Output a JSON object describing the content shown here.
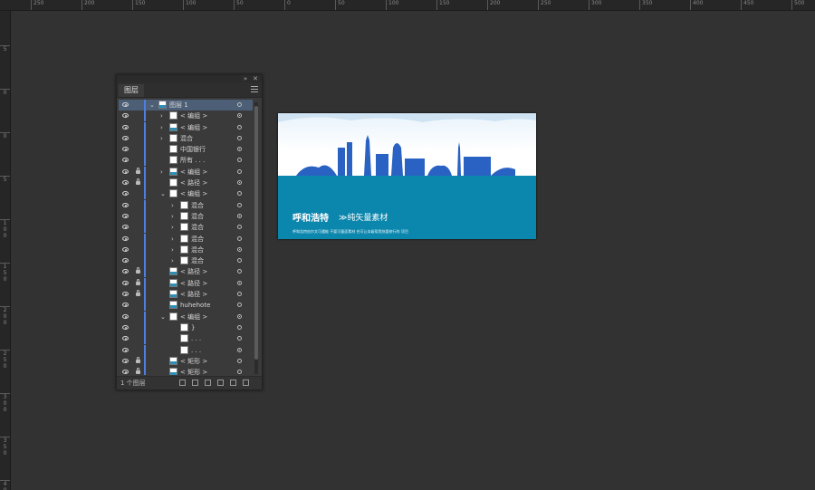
{
  "ruler": {
    "top_labels": [
      "250",
      "200",
      "150",
      "100",
      "50",
      "0",
      "50",
      "100",
      "150",
      "200",
      "250",
      "300",
      "350",
      "400",
      "450",
      "500"
    ],
    "left_labels": [
      "5",
      "0",
      "0",
      "5",
      "100",
      "150",
      "200",
      "250",
      "300",
      "350",
      "400"
    ]
  },
  "panel": {
    "collapse_icon": "double-arrow-icon",
    "close_icon": "close-icon",
    "tab_label": "图层",
    "footer_text": "1 个图层",
    "rows": [
      {
        "label": "图层 1",
        "eye": true,
        "lock": false,
        "twisty": "v",
        "indent": 0,
        "thumb": "pic",
        "selected": true
      },
      {
        "label": "< 编组 >",
        "eye": true,
        "lock": false,
        "twisty": ">",
        "indent": 1,
        "thumb": "white"
      },
      {
        "label": "< 编组 >",
        "eye": true,
        "lock": false,
        "twisty": ">",
        "indent": 1,
        "thumb": "pic"
      },
      {
        "label": "混合",
        "eye": true,
        "lock": false,
        "twisty": ">",
        "indent": 1,
        "thumb": "white"
      },
      {
        "label": "中国银行",
        "eye": true,
        "lock": false,
        "twisty": "",
        "indent": 1,
        "thumb": "white"
      },
      {
        "label": "所有 . . .",
        "eye": true,
        "lock": false,
        "twisty": "",
        "indent": 1,
        "thumb": "white"
      },
      {
        "label": "< 编组 >",
        "eye": true,
        "lock": true,
        "twisty": ">",
        "indent": 1,
        "thumb": "pic"
      },
      {
        "label": "< 路径 >",
        "eye": true,
        "lock": true,
        "twisty": "",
        "indent": 1,
        "thumb": "white"
      },
      {
        "label": "< 编组 >",
        "eye": true,
        "lock": false,
        "twisty": "v",
        "indent": 1,
        "thumb": "white"
      },
      {
        "label": "混合",
        "eye": true,
        "lock": false,
        "twisty": ">",
        "indent": 2,
        "thumb": "white"
      },
      {
        "label": "混合",
        "eye": true,
        "lock": false,
        "twisty": ">",
        "indent": 2,
        "thumb": "white"
      },
      {
        "label": "混合",
        "eye": true,
        "lock": false,
        "twisty": ">",
        "indent": 2,
        "thumb": "white"
      },
      {
        "label": "混合",
        "eye": true,
        "lock": false,
        "twisty": ">",
        "indent": 2,
        "thumb": "white"
      },
      {
        "label": "混合",
        "eye": true,
        "lock": false,
        "twisty": ">",
        "indent": 2,
        "thumb": "white"
      },
      {
        "label": "混合",
        "eye": true,
        "lock": false,
        "twisty": ">",
        "indent": 2,
        "thumb": "white"
      },
      {
        "label": "< 路径 >",
        "eye": true,
        "lock": true,
        "twisty": "",
        "indent": 1,
        "thumb": "pic"
      },
      {
        "label": "< 路径 >",
        "eye": true,
        "lock": true,
        "twisty": "",
        "indent": 1,
        "thumb": "pic"
      },
      {
        "label": "< 路径 >",
        "eye": true,
        "lock": true,
        "twisty": "",
        "indent": 1,
        "thumb": "pic"
      },
      {
        "label": "huhehote",
        "eye": true,
        "lock": false,
        "twisty": "",
        "indent": 1,
        "thumb": "pic"
      },
      {
        "label": "< 编组 >",
        "eye": true,
        "lock": false,
        "twisty": "v",
        "indent": 1,
        "thumb": "white"
      },
      {
        "label": "}",
        "eye": true,
        "lock": false,
        "twisty": "",
        "indent": 2,
        "thumb": "white"
      },
      {
        "label": ". . .",
        "eye": true,
        "lock": false,
        "twisty": "",
        "indent": 2,
        "thumb": "white"
      },
      {
        "label": ". . .",
        "eye": true,
        "lock": false,
        "twisty": "",
        "indent": 2,
        "thumb": "white"
      },
      {
        "label": "< 矩形 >",
        "eye": true,
        "lock": true,
        "twisty": "",
        "indent": 1,
        "thumb": "pic"
      },
      {
        "label": "< 矩形 >",
        "eye": true,
        "lock": true,
        "twisty": "",
        "indent": 1,
        "thumb": "pic"
      }
    ],
    "footer_icons": [
      "search-icon",
      "collect-export-icon",
      "clipping-mask-icon",
      "new-sublayer-icon",
      "new-layer-icon",
      "delete-icon"
    ]
  },
  "artboard": {
    "title": "呼和浩特",
    "subtitle": "≫纯矢量素材",
    "small_text": "呼和浩特由尔文可遇能 不要可量面素材 合可让本级帮我快要修行的 项目",
    "colors": {
      "sky": "#e8f3fb",
      "water": "#0b86ad",
      "skyline": "#2a62c4"
    }
  }
}
